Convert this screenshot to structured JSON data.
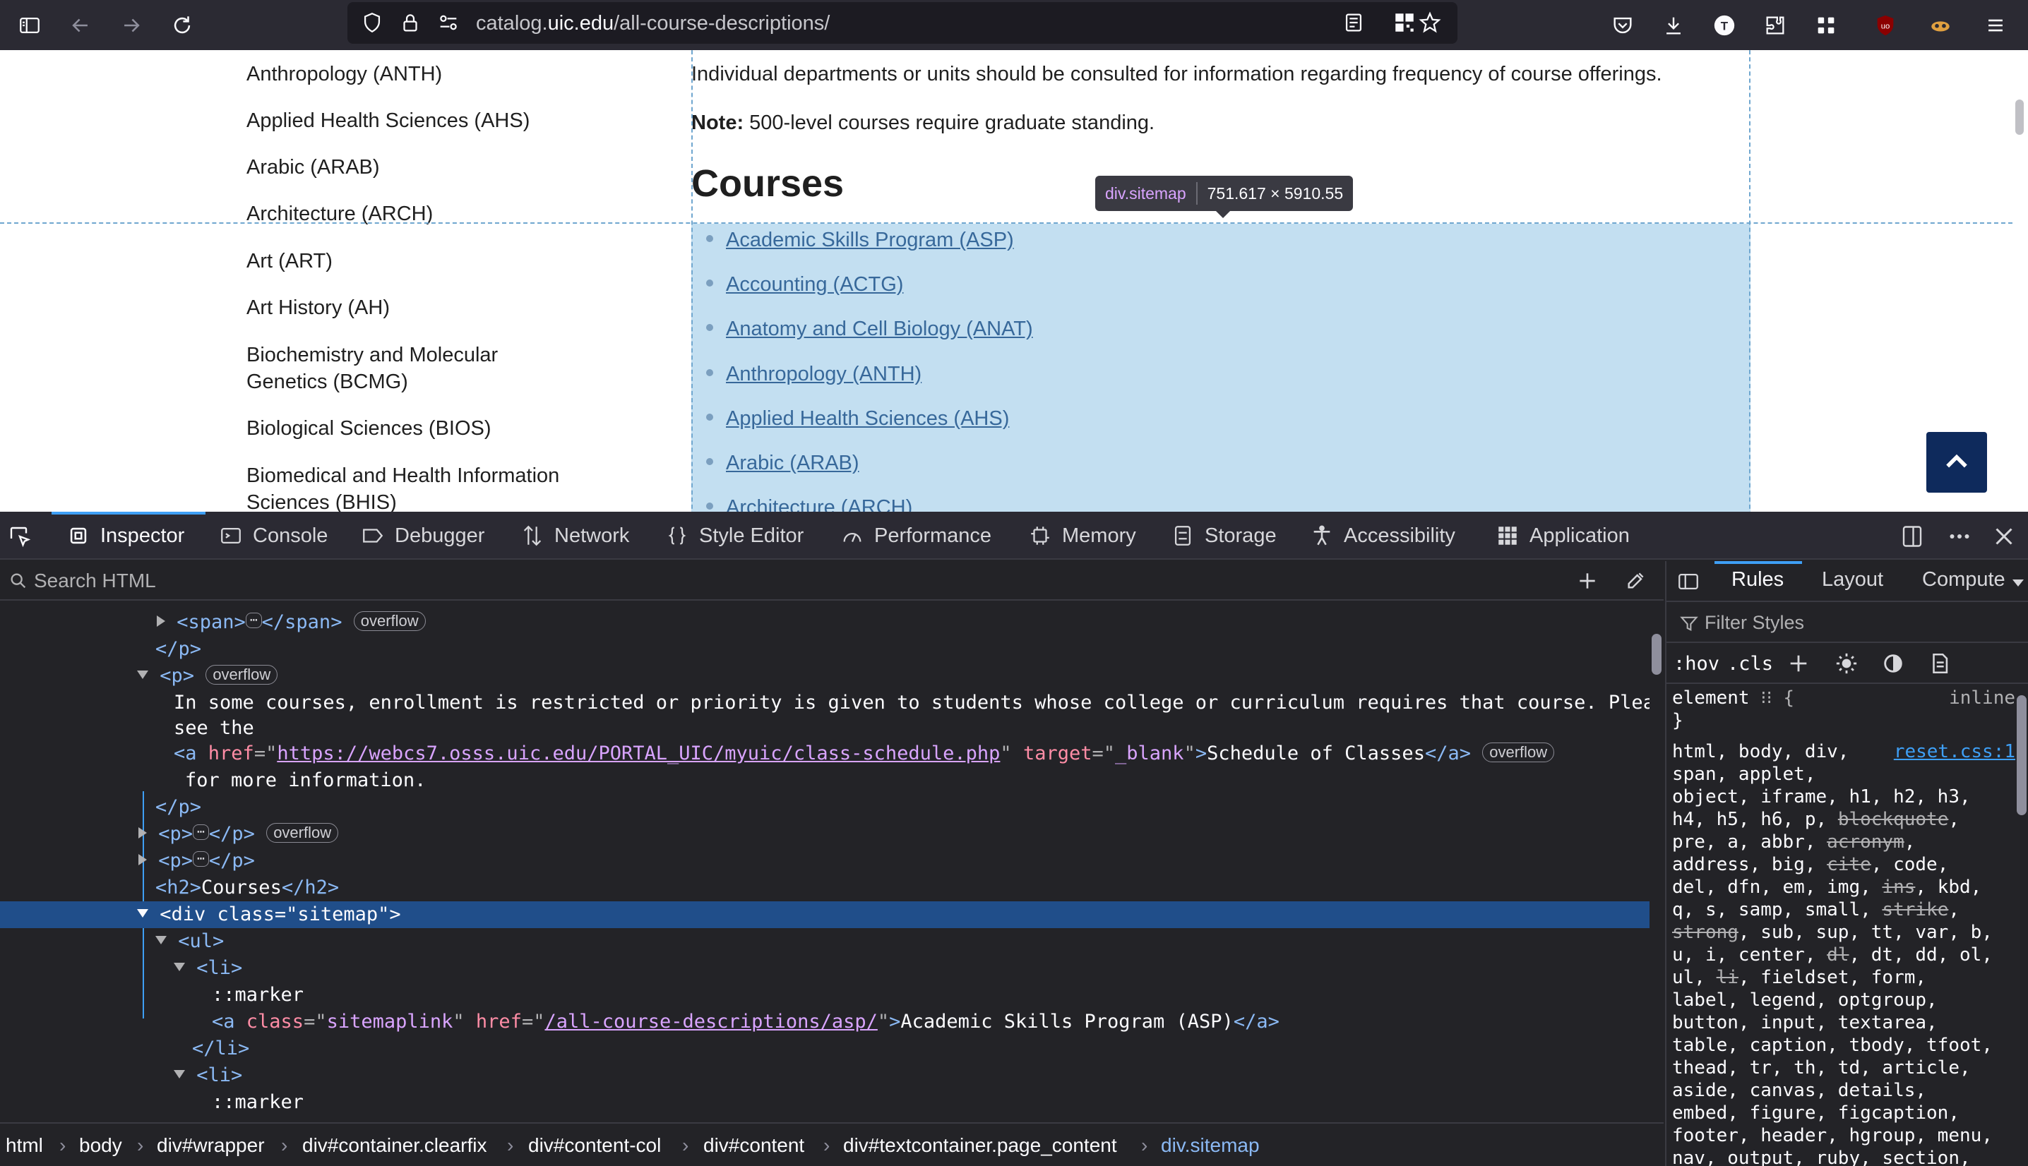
{
  "browser": {
    "url_path_prefix": "catalog.",
    "url_host": "uic.edu",
    "url_path": "/all-course-descriptions/"
  },
  "page": {
    "sidebar": [
      "Anthropology (ANTH)",
      "Applied Health Sciences (AHS)",
      "Arabic (ARAB)",
      "Architecture (ARCH)",
      "Art (ART)",
      "Art History (AH)",
      "Biochemistry and Molecular Genetics (BCMG)",
      "Biological Sciences (BIOS)",
      "Biomedical and Health Information Sciences (BHIS)"
    ],
    "intro_line1": "Individual departments or units should be consulted for information regarding frequency of course offerings.",
    "note_label": "Note:",
    "note_text": " 500-level courses require graduate standing.",
    "courses_heading": "Courses",
    "courses": [
      "Academic Skills Program (ASP)",
      "Accounting (ACTG)",
      "Anatomy and Cell Biology (ANAT)",
      "Anthropology (ANTH)",
      "Applied Health Sciences (AHS)",
      "Arabic (ARAB)",
      "Architecture (ARCH)"
    ]
  },
  "highlighter": {
    "tag": "div.sitemap",
    "dimensions": "751.617 × 5910.55"
  },
  "devtools": {
    "tabs": [
      "Inspector",
      "Console",
      "Debugger",
      "Network",
      "Style Editor",
      "Performance",
      "Memory",
      "Storage",
      "Accessibility",
      "Application"
    ],
    "search_placeholder": "Search HTML",
    "markup": {
      "span_open": "<span>",
      "span_close": "</span>",
      "p_close": "</p>",
      "p_open": "<p>",
      "overflow": "overflow",
      "text_1": "In some courses, enrollment is restricted or priority is given to students whose college or curriculum requires that course. Please",
      "text_2": "see the",
      "a_open": "<a ",
      "href_attr": "href",
      "href_val": "https://webcs7.osss.uic.edu/PORTAL_UIC/myuic/class-schedule.php",
      "target_attr": "target",
      "target_val": "_blank",
      "a_text": "Schedule of Classes",
      "a_close": "</a>",
      "text_3": "for more information.",
      "h2_text": "Courses",
      "div_class_val": "sitemap",
      "ul_open": "<ul>",
      "li_open": "<li>",
      "li_close": "</li>",
      "marker": "::marker",
      "sitemaplink_class": "sitemaplink",
      "asp_href": "/all-course-descriptions/asp/",
      "asp_text": "Academic Skills Program (ASP)"
    },
    "breadcrumbs": [
      "html",
      "body",
      "div#wrapper",
      "div#container.clearfix",
      "div#content-col",
      "div#content",
      "div#textcontainer.page_content",
      "div.sitemap"
    ],
    "rules_tabs": [
      "Rules",
      "Layout",
      "Compute"
    ],
    "filter_placeholder": "Filter Styles",
    "pseudo_hov": ":hov",
    "pseudo_cls": ".cls",
    "element_rule": "element",
    "element_source": "inline",
    "reset_source": "reset.css:1"
  }
}
